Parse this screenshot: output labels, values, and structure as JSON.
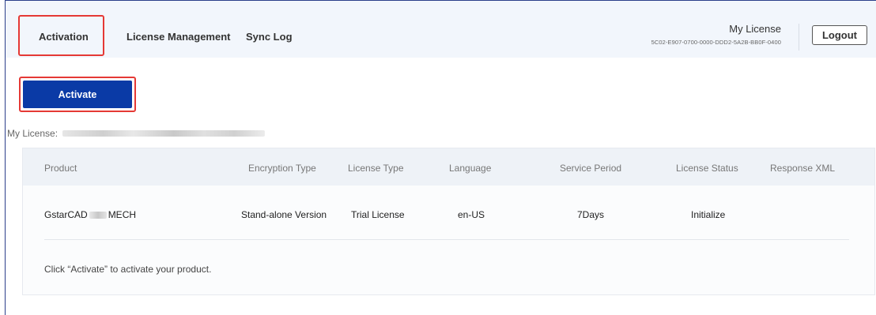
{
  "tabs": [
    {
      "label": "Activation"
    },
    {
      "label": "License Management"
    },
    {
      "label": "Sync Log"
    }
  ],
  "header": {
    "my_license_title": "My License",
    "license_key": "5C02-E907-0700-0000-DDD2-5A2B-BB0F-0400",
    "logout_label": "Logout"
  },
  "activate_label": "Activate",
  "my_license_label": "My License:",
  "table": {
    "columns": [
      "Product",
      "Encryption Type",
      "License Type",
      "Language",
      "Service Period",
      "License Status",
      "Response XML"
    ],
    "rows": [
      {
        "product_prefix": "GstarCAD",
        "product_suffix": "MECH",
        "encryption_type": "Stand-alone Version",
        "license_type": "Trial License",
        "language": "en-US",
        "service_period": "7Days",
        "license_status": "Initialize",
        "response_xml": ""
      }
    ],
    "hint": "Click “Activate” to activate your product."
  },
  "colors": {
    "accent": "#0a3aa6",
    "highlight": "#e53935",
    "topbar_bg": "#f2f6fc"
  }
}
